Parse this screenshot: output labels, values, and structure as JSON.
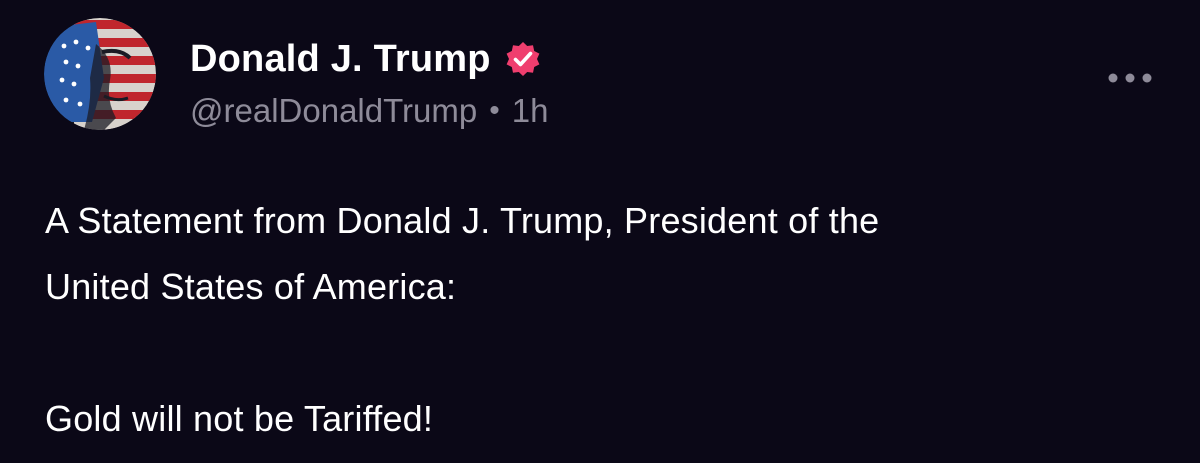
{
  "post": {
    "author": {
      "display_name": "Donald J. Trump",
      "handle": "@realDonaldTrump",
      "verified": true,
      "verified_color": "#ef3e6e"
    },
    "separator": "•",
    "timestamp": "1h",
    "more_menu_icon": "ellipsis-icon",
    "body": {
      "line1": "A Statement from Donald J. Trump, President of the",
      "line2": "United States of America:",
      "line3": "Gold will not be Tariffed!"
    }
  },
  "colors": {
    "background": "#0b0817",
    "primary_text": "#ffffff",
    "secondary_text": "#8e8b99"
  }
}
